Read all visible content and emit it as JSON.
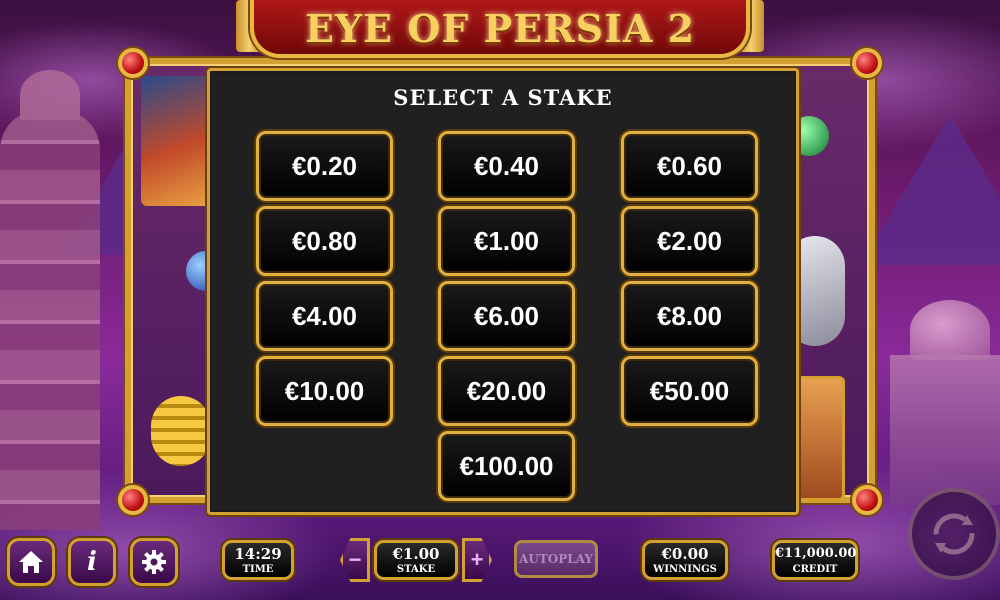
{
  "game": {
    "title": "EYE OF PERSIA 2"
  },
  "stake_dialog": {
    "title": "SELECT A STAKE",
    "options": [
      "€0.20",
      "€0.40",
      "€0.60",
      "€0.80",
      "€1.00",
      "€2.00",
      "€4.00",
      "€6.00",
      "€8.00",
      "€10.00",
      "€20.00",
      "€50.00",
      "€100.00"
    ]
  },
  "bottom_bar": {
    "time": {
      "value": "14:29",
      "label": "TIME"
    },
    "stake": {
      "value": "€1.00",
      "label": "STAKE",
      "minus": "−",
      "plus": "+"
    },
    "autoplay": "AUTOPLAY",
    "winnings": {
      "value": "€0.00",
      "label": "WINNINGS"
    },
    "credit": {
      "value": "€11,000.00",
      "label": "CREDIT"
    },
    "info_glyph": "i"
  },
  "icons": [
    "home-icon",
    "info-icon",
    "gear-icon",
    "spin-icon"
  ],
  "colors": {
    "gold": "#d4a030",
    "dialog_bg": "#202020",
    "title_red": "#b01818"
  }
}
